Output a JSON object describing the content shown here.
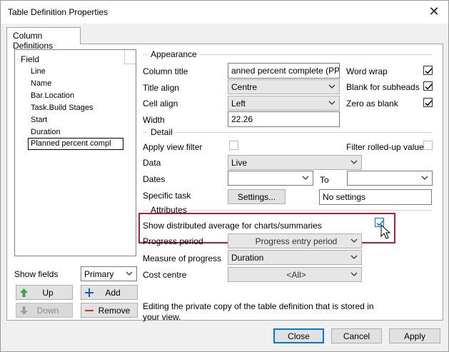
{
  "window": {
    "title": "Table Definition Properties",
    "close_glyph": "✕"
  },
  "tabs": [
    {
      "label": "Column Definitions"
    }
  ],
  "field_list": {
    "header": "Field",
    "items": [
      "Line",
      "Name",
      "Bar.Location",
      "Task.Build Stages",
      "Start",
      "Duration"
    ],
    "selected": "Planned percent compl"
  },
  "show_fields": {
    "label": "Show fields",
    "value": "Primary"
  },
  "list_buttons": {
    "up": "Up",
    "add": "Add",
    "down": "Down",
    "remove": "Remove"
  },
  "appearance": {
    "heading": "Appearance",
    "column_title_label": "Column title",
    "column_title_value": "anned percent complete (PPC)",
    "title_align_label": "Title align",
    "title_align_value": "Centre",
    "cell_align_label": "Cell align",
    "cell_align_value": "Left",
    "width_label": "Width",
    "width_value": "22.26",
    "word_wrap_label": "Word wrap",
    "blank_subheads_label": "Blank for subheads",
    "zero_blank_label": "Zero as blank"
  },
  "detail": {
    "heading": "Detail",
    "apply_view_filter_label": "Apply view filter",
    "filter_rolled_label": "Filter rolled-up values",
    "data_label": "Data",
    "data_value": "Live",
    "dates_label": "Dates",
    "dates_from_value": "",
    "to_label": "To",
    "dates_to_value": "",
    "specific_task_label": "Specific task",
    "settings_button": "Settings...",
    "settings_value": "No settings"
  },
  "attributes": {
    "heading": "Attributes",
    "show_dist_label": "Show distributed average for charts/summaries",
    "progress_period_label": "Progress period",
    "progress_period_value": "Progress entry period",
    "measure_label": "Measure of progress",
    "measure_value": "Duration",
    "cost_centre_label": "Cost centre",
    "cost_centre_value": "<All>"
  },
  "info_text": "Editing the private copy of the table definition that is stored in your view.",
  "footer": {
    "close": "Close",
    "cancel": "Cancel",
    "apply": "Apply"
  },
  "colors": {
    "highlight": "#a6223a",
    "accent": "#0078d7",
    "up_arrow": "#3aa34a",
    "add_plus": "#1e5aa8",
    "remove_minus": "#c0392b"
  }
}
